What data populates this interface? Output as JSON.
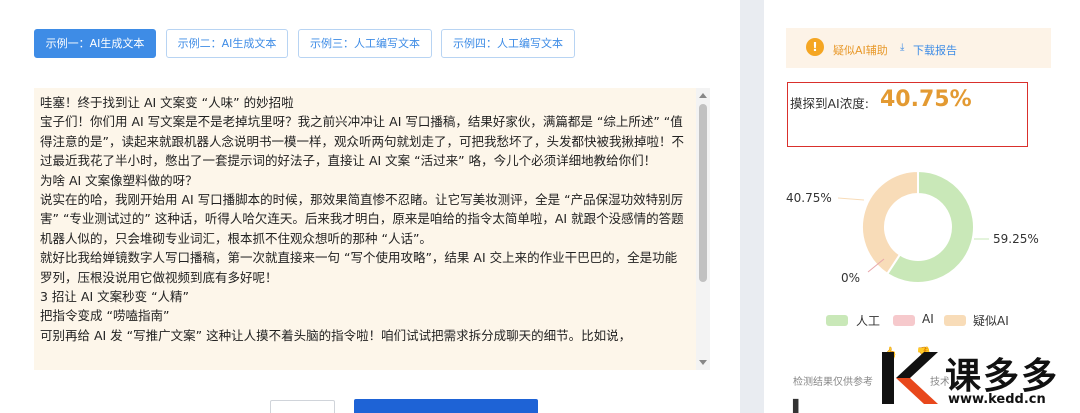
{
  "tabs": [
    {
      "label": "示例一：AI生成文本",
      "active": true
    },
    {
      "label": "示例二：AI生成文本",
      "active": false
    },
    {
      "label": "示例三：人工编写文本",
      "active": false
    },
    {
      "label": "示例四：人工编写文本",
      "active": false
    }
  ],
  "article": {
    "paragraphs": [
      "哇塞！终于找到让 AI 文案变 “人味” 的妙招啦",
      "宝子们！你们用 AI 写文案是不是老掉坑里呀？我之前兴冲冲让 AI 写口播稿，结果好家伙，满篇都是 “综上所述” “值得注意的是”，读起来就跟机器人念说明书一模一样，观众听两句就划走了，可把我愁坏了，头发都快被我揪掉啦！不过最近我花了半小时，憋出了一套提示词的好法子，直接让 AI 文案 “活过来” 咯，今儿个必须详细地教给你们！",
      "为啥 AI 文案像塑料做的呀？",
      "说实在的哈，我刚开始用 AI 写口播脚本的时候，那效果简直惨不忍睹。让它写美妆测评，全是 “产品保湿功效特别厉害” “专业测试过的” 这种话，听得人哈欠连天。后来我才明白，原来是咱给的指令太简单啦，AI 就跟个没感情的答题机器人似的，只会堆砌专业词汇，根本抓不住观众想听的那种 “人话”。",
      "就好比我给婵镜数字人写口播稿，第一次就直接来一句 “写个使用攻略”，结果 AI 交上来的作业干巴巴的，全是功能罗列，压根没说用它做视频到底有多好呢！",
      "3 招让 AI 文案秒变 “人精”",
      "把指令变成 “唠嗑指南”",
      "可别再给 AI 发 “写推广文案” 这种让人摸不着头脑的指令啦！咱们试试把需求拆分成聊天的细节。比如说，"
    ]
  },
  "report": {
    "warning_label": "疑似AI辅助",
    "warning_icon": "warning-icon",
    "download_icon": "download-icon",
    "download_label": "下载报告",
    "score_label": "摸探到AI浓度:",
    "score_value": "40.75%",
    "footer_note": "检测结果仅供参考",
    "footer_note_tail": "技术"
  },
  "chart_data": {
    "type": "pie",
    "variant": "donut",
    "categories": [
      "人工",
      "AI",
      "疑似AI"
    ],
    "values": [
      59.25,
      0,
      40.75
    ],
    "labels": [
      "59.25%",
      "0%",
      "40.75%"
    ],
    "colors": [
      "#c9e8b8",
      "#f6c9cc",
      "#f8dcb8"
    ],
    "legend_position": "bottom"
  },
  "watermark": {
    "brand": "课多多",
    "url": "www.kedd.cn"
  },
  "colors": {
    "accent": "#3e8ce6",
    "warning": "#f5a623",
    "score": "#e39a32",
    "highlight_frame": "#d9302c",
    "text_bg": "#fdf6ea"
  }
}
